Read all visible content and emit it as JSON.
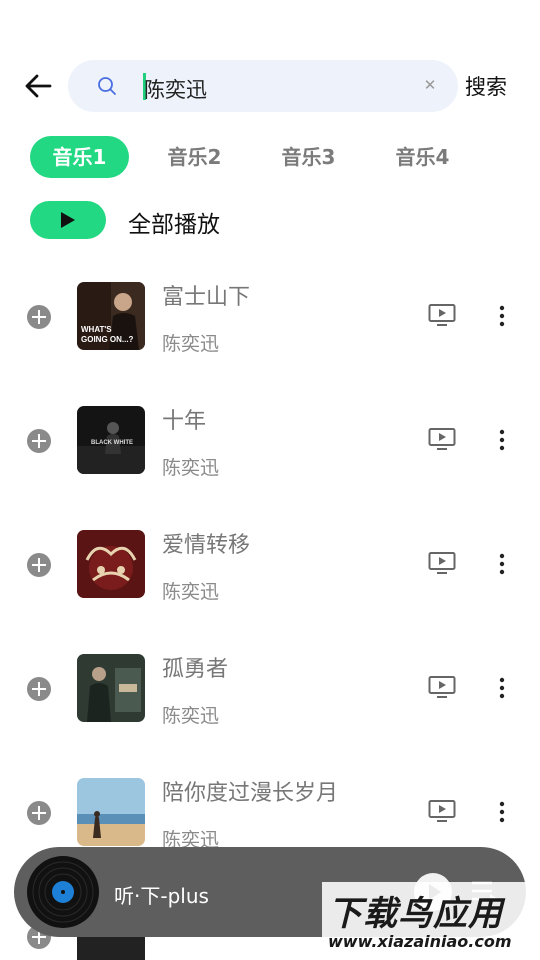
{
  "search": {
    "query": "陈奕迅",
    "button_label": "搜索"
  },
  "tabs": [
    {
      "label": "音乐1",
      "active": true
    },
    {
      "label": "音乐2",
      "active": false
    },
    {
      "label": "音乐3",
      "active": false
    },
    {
      "label": "音乐4",
      "active": false
    }
  ],
  "play_all": {
    "label": "全部播放"
  },
  "songs": [
    {
      "title": "富士山下",
      "artist": "陈奕迅",
      "cover_text": "WHAT'S GOING ON...?"
    },
    {
      "title": "十年",
      "artist": "陈奕迅",
      "cover_text": "BLACK WHITE"
    },
    {
      "title": "爱情转移",
      "artist": "陈奕迅",
      "cover_text": ""
    },
    {
      "title": "孤勇者",
      "artist": "陈奕迅",
      "cover_text": ""
    },
    {
      "title": "陪你度过漫长岁月",
      "artist": "陈奕迅",
      "cover_text": ""
    }
  ],
  "player": {
    "title": "听·下-plus"
  },
  "watermark": {
    "main": "下载鸟应用",
    "sub": "www.xiazainiao.com"
  },
  "colors": {
    "accent": "#23d882",
    "player_bg": "#5e5e5e",
    "search_bg": "#eef2fb"
  }
}
